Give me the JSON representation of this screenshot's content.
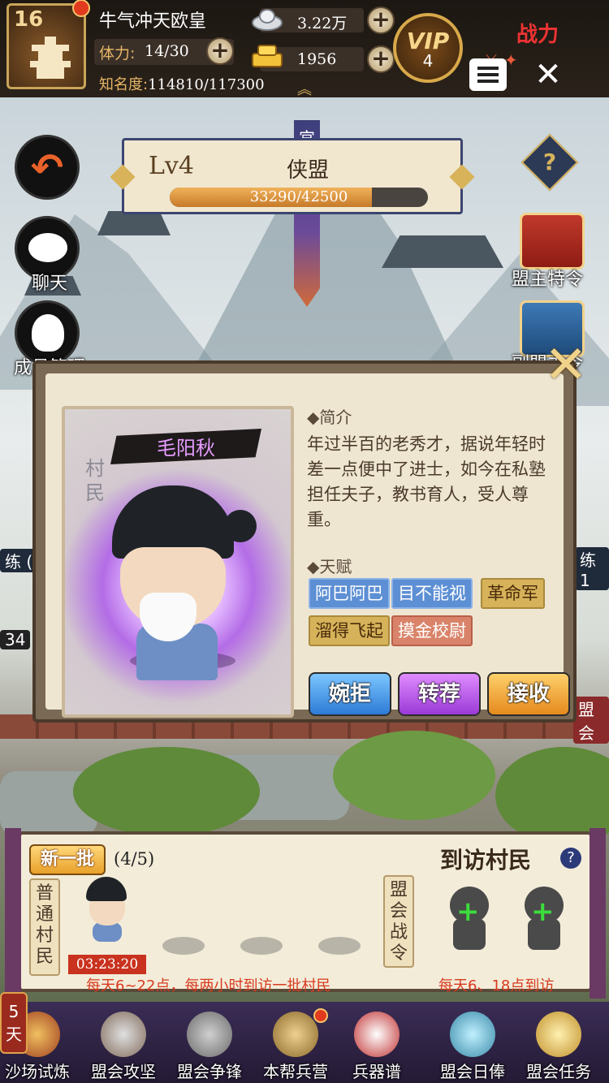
{
  "player": {
    "level": "16",
    "name": "牛气冲天欧皇",
    "stamina_label": "体力:",
    "stamina_value": "14/30",
    "fame_label": "知名度:",
    "fame_value": "114810/117300",
    "silver": "3.22万",
    "gold": "1956",
    "vip_label": "VIP",
    "vip_level": "4",
    "power_label": "战力"
  },
  "league": {
    "level": "Lv4",
    "name": "侠盟",
    "xp_text": "33290/42500",
    "xp_progress": 0.783,
    "banner_text": "宫"
  },
  "side_buttons": {
    "chat": "聊天",
    "members": "成员管理",
    "chest1": "盟主特令",
    "chest2": "副盟主令"
  },
  "villager": {
    "name": "毛阳秋",
    "role": "村民",
    "intro_title": "◆简介",
    "intro": "年过半百的老秀才，据说年轻时差一点便中了进士，如今在私塾担任夫子，教书育人，受人尊重。",
    "talent_title": "◆天赋",
    "talents": [
      {
        "label": "阿巴阿巴",
        "color": "blue"
      },
      {
        "label": "目不能视",
        "color": "blue"
      },
      {
        "label": "革命军",
        "color": "gold"
      },
      {
        "label": "溜得飞起",
        "color": "gold"
      },
      {
        "label": "摸金校尉",
        "color": "red"
      }
    ],
    "actions": {
      "reject": "婉拒",
      "refer": "转荐",
      "accept": "接收"
    }
  },
  "peek": {
    "left_tag": "练 (",
    "left_num": "34",
    "right_tag": "练 1",
    "right_text": "盟会"
  },
  "visitors": {
    "new_batch": "新一批",
    "count": "(4/5)",
    "title": "到访村民",
    "common_label": "普通村民",
    "pass_label": "盟会战令",
    "timer": "03:23:20",
    "hint_left": "每天6~22点，每两小时到访一批村民",
    "hint_right": "每天6、18点到访"
  },
  "nav": {
    "days": "5天",
    "items": [
      "沙场试炼",
      "盟会攻坚",
      "盟会争锋",
      "本帮兵营",
      "兵器谱",
      "盟会日俸",
      "盟会任务"
    ]
  }
}
